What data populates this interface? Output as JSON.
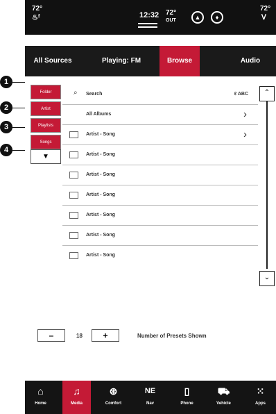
{
  "status_bar": {
    "left_temp": "72°",
    "time": "12:32",
    "out_temp": "72°",
    "out_label": "OUT",
    "right_temp": "72°",
    "icons": [
      "seat-heat-icon",
      "user-icon",
      "mic-icon",
      "steering-heat-icon"
    ]
  },
  "tabs": [
    {
      "label": "All Sources"
    },
    {
      "label": "Playing: FM"
    },
    {
      "label": "Browse"
    },
    {
      "label": "Audio"
    }
  ],
  "active_tab": "Browse",
  "sidebar": {
    "buttons": [
      {
        "label": "Folder"
      },
      {
        "label": "Artist"
      },
      {
        "label": "Playlists"
      },
      {
        "label": "Songs"
      }
    ],
    "down_label": "▼"
  },
  "callouts": [
    "1",
    "2",
    "3",
    "4"
  ],
  "search": {
    "label": "Search",
    "abc": "ABC"
  },
  "list": {
    "all_albums": "All Albums",
    "items": [
      "Artist - Song",
      "Artist - Song",
      "Artist - Song",
      "Artist - Song",
      "Artist - Song",
      "Artist - Song",
      "Artist - Song"
    ]
  },
  "presets": {
    "minus": "–",
    "count": "18",
    "plus": "+",
    "label": "Number of Presets Shown"
  },
  "nav": [
    {
      "label": "Home",
      "icon": "home-icon"
    },
    {
      "label": "Media",
      "icon": "music-icon"
    },
    {
      "label": "Comfort",
      "icon": "comfort-icon"
    },
    {
      "label": "Nav",
      "icon": "compass-icon",
      "text": "NE"
    },
    {
      "label": "Phone",
      "icon": "phone-icon"
    },
    {
      "label": "Vehicle",
      "icon": "car-icon"
    },
    {
      "label": "Apps",
      "icon": "apps-icon"
    }
  ],
  "colors": {
    "accent": "#c41a36",
    "bar": "#141414"
  }
}
